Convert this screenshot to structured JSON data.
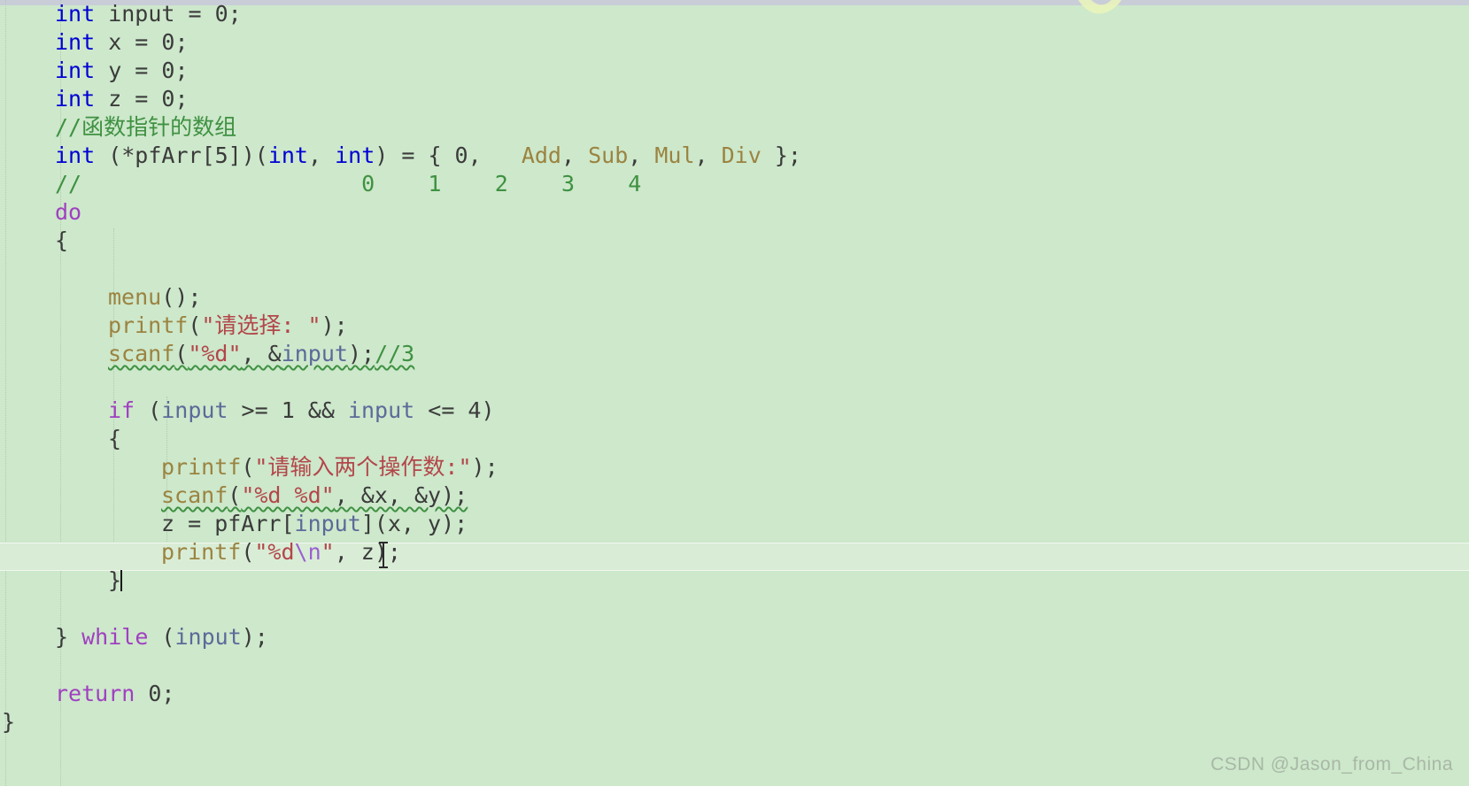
{
  "editor": {
    "language": "C",
    "background_color": "#cde8cb",
    "current_line_highlight_color": "#d9edd6",
    "font_size_px": 25,
    "line_height_px": 32,
    "colors": {
      "keyword": "#0000d4",
      "control": "#a040c0",
      "function": "#9b8340",
      "string": "#b3464a",
      "escape": "#9b5fd0",
      "comment": "#3f9142",
      "variable": "#5b6a99",
      "plain": "#3b3b3b",
      "squiggle": "#3f9142"
    }
  },
  "code_lines": [
    {
      "id": "l01",
      "indent": 2,
      "tokens": [
        {
          "t": "int",
          "c": "kw"
        },
        {
          "t": " input = 0;",
          "c": "plain"
        }
      ]
    },
    {
      "id": "l02",
      "indent": 2,
      "tokens": [
        {
          "t": "int",
          "c": "kw"
        },
        {
          "t": " x = 0;",
          "c": "plain"
        }
      ]
    },
    {
      "id": "l03",
      "indent": 2,
      "tokens": [
        {
          "t": "int",
          "c": "kw"
        },
        {
          "t": " y = 0;",
          "c": "plain"
        }
      ]
    },
    {
      "id": "l04",
      "indent": 2,
      "tokens": [
        {
          "t": "int",
          "c": "kw"
        },
        {
          "t": " z = 0;",
          "c": "plain"
        }
      ]
    },
    {
      "id": "l05",
      "indent": 2,
      "tokens": [
        {
          "t": "//函数指针的数组",
          "c": "cmt"
        }
      ]
    },
    {
      "id": "l06",
      "indent": 2,
      "tokens": [
        {
          "t": "int",
          "c": "kw"
        },
        {
          "t": " (*pfArr[5])(",
          "c": "plain"
        },
        {
          "t": "int",
          "c": "kw"
        },
        {
          "t": ", ",
          "c": "plain"
        },
        {
          "t": "int",
          "c": "kw"
        },
        {
          "t": ") = { 0,   ",
          "c": "plain"
        },
        {
          "t": "Add",
          "c": "fn"
        },
        {
          "t": ", ",
          "c": "plain"
        },
        {
          "t": "Sub",
          "c": "fn"
        },
        {
          "t": ", ",
          "c": "plain"
        },
        {
          "t": "Mul",
          "c": "fn"
        },
        {
          "t": ", ",
          "c": "plain"
        },
        {
          "t": "Div",
          "c": "fn"
        },
        {
          "t": " };",
          "c": "plain"
        }
      ]
    },
    {
      "id": "l07",
      "indent": 2,
      "tokens": [
        {
          "t": "//                     0    1    2    3    4",
          "c": "cmt"
        }
      ]
    },
    {
      "id": "l08",
      "indent": 2,
      "tokens": [
        {
          "t": "do",
          "c": "ctrl"
        }
      ]
    },
    {
      "id": "l09",
      "indent": 2,
      "tokens": [
        {
          "t": "{",
          "c": "plain"
        }
      ]
    },
    {
      "id": "l10",
      "indent": 0,
      "tokens": []
    },
    {
      "id": "l11",
      "indent": 4,
      "tokens": [
        {
          "t": "menu",
          "c": "fn"
        },
        {
          "t": "();",
          "c": "plain"
        }
      ]
    },
    {
      "id": "l12",
      "indent": 4,
      "tokens": [
        {
          "t": "printf",
          "c": "fn"
        },
        {
          "t": "(",
          "c": "plain"
        },
        {
          "t": "\"请选择: \"",
          "c": "str"
        },
        {
          "t": ");",
          "c": "plain"
        }
      ]
    },
    {
      "id": "l13",
      "indent": 4,
      "squiggle": true,
      "tokens": [
        {
          "t": "scanf",
          "c": "fn"
        },
        {
          "t": "(",
          "c": "plain"
        },
        {
          "t": "\"%d\"",
          "c": "str"
        },
        {
          "t": ", &",
          "c": "plain"
        },
        {
          "t": "input",
          "c": "var"
        },
        {
          "t": ");",
          "c": "plain"
        },
        {
          "t": "//3",
          "c": "cmt",
          "nosquiggle": true
        }
      ]
    },
    {
      "id": "l14",
      "indent": 0,
      "tokens": []
    },
    {
      "id": "l15",
      "indent": 4,
      "tokens": [
        {
          "t": "if",
          "c": "ctrl"
        },
        {
          "t": " (",
          "c": "plain"
        },
        {
          "t": "input",
          "c": "var"
        },
        {
          "t": " >= 1 && ",
          "c": "plain"
        },
        {
          "t": "input",
          "c": "var"
        },
        {
          "t": " <= 4)",
          "c": "plain"
        }
      ]
    },
    {
      "id": "l16",
      "indent": 4,
      "tokens": [
        {
          "t": "{",
          "c": "plain"
        }
      ]
    },
    {
      "id": "l17",
      "indent": 6,
      "tokens": [
        {
          "t": "printf",
          "c": "fn"
        },
        {
          "t": "(",
          "c": "plain"
        },
        {
          "t": "\"请输入两个操作数:\"",
          "c": "str"
        },
        {
          "t": ");",
          "c": "plain"
        }
      ]
    },
    {
      "id": "l18",
      "indent": 6,
      "squiggle": true,
      "tokens": [
        {
          "t": "scanf",
          "c": "fn"
        },
        {
          "t": "(",
          "c": "plain"
        },
        {
          "t": "\"%d %d\"",
          "c": "str"
        },
        {
          "t": ", &x, &y);",
          "c": "plain"
        }
      ]
    },
    {
      "id": "l19",
      "indent": 6,
      "tokens": [
        {
          "t": "z = pfArr[",
          "c": "plain"
        },
        {
          "t": "input",
          "c": "var"
        },
        {
          "t": "](x, y);",
          "c": "plain"
        }
      ]
    },
    {
      "id": "l20",
      "indent": 6,
      "tokens": [
        {
          "t": "printf",
          "c": "fn"
        },
        {
          "t": "(",
          "c": "plain"
        },
        {
          "t": "\"%d",
          "c": "str"
        },
        {
          "t": "\\n",
          "c": "esc"
        },
        {
          "t": "\"",
          "c": "str"
        },
        {
          "t": ", z);",
          "c": "plain"
        }
      ]
    },
    {
      "id": "l21",
      "indent": 4,
      "current": true,
      "caret": true,
      "tokens": [
        {
          "t": "}",
          "c": "plain"
        }
      ]
    },
    {
      "id": "l22",
      "indent": 0,
      "tokens": []
    },
    {
      "id": "l23",
      "indent": 2,
      "tokens": [
        {
          "t": "} ",
          "c": "plain"
        },
        {
          "t": "while",
          "c": "ctrl"
        },
        {
          "t": " (",
          "c": "plain"
        },
        {
          "t": "input",
          "c": "var"
        },
        {
          "t": ");",
          "c": "plain"
        }
      ]
    },
    {
      "id": "l24",
      "indent": 0,
      "tokens": []
    },
    {
      "id": "l25",
      "indent": 2,
      "tokens": [
        {
          "t": "return",
          "c": "ctrl"
        },
        {
          "t": " 0;",
          "c": "plain"
        }
      ]
    },
    {
      "id": "l26",
      "indent": 0,
      "tokens": [
        {
          "t": "}",
          "c": "plain"
        }
      ]
    }
  ],
  "watermarks": {
    "diagonal_text": "CSDN",
    "bottom_right_text": "CSDN @Jason_from_China"
  },
  "cursor": {
    "caret_line_id": "l21",
    "mouse_pointer": "text-ibeam"
  }
}
